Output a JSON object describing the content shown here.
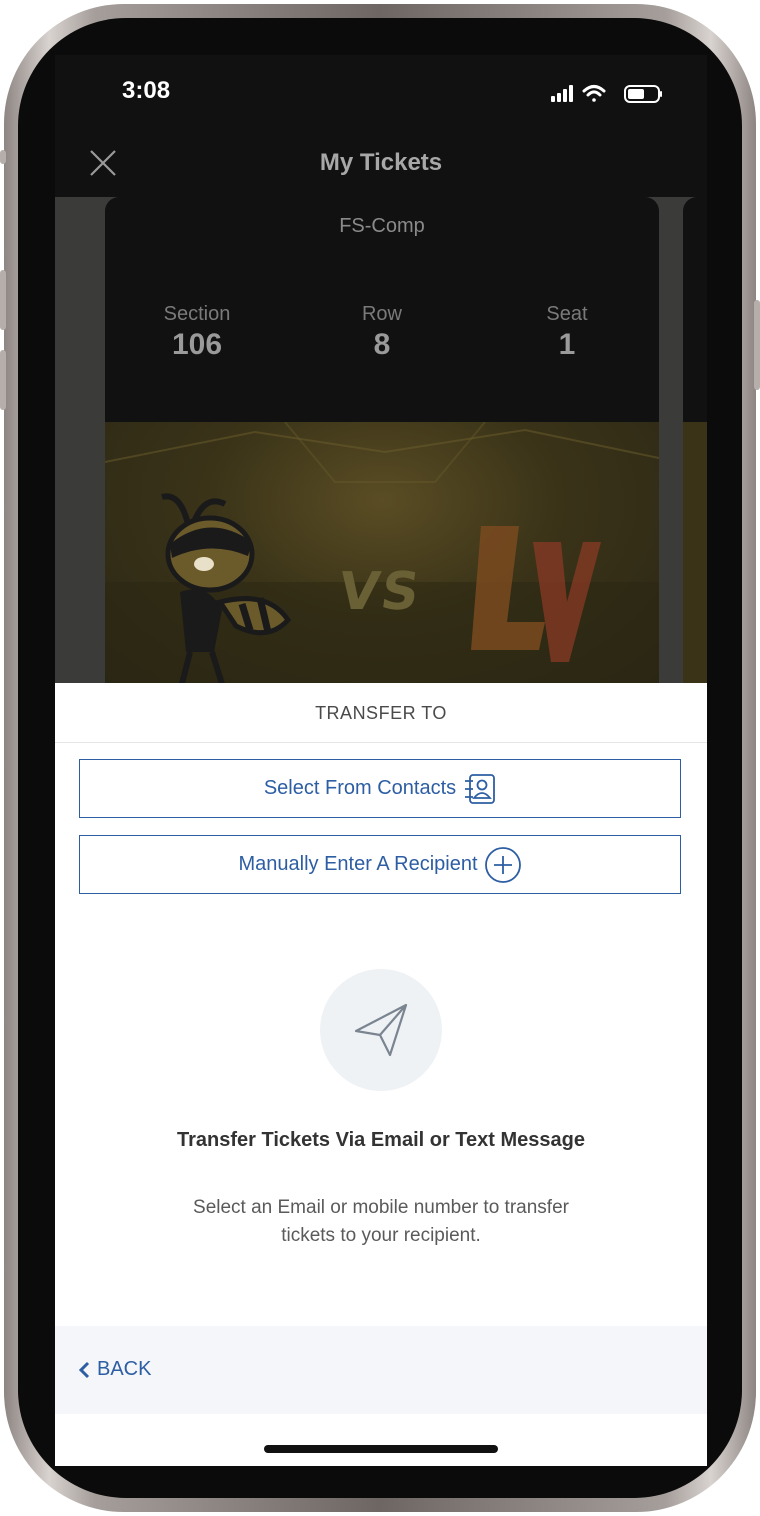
{
  "status_bar": {
    "time": "3:08"
  },
  "nav": {
    "title": "My Tickets"
  },
  "ticket": {
    "price_code": "FS-Comp",
    "section_label": "Section",
    "section_value": "106",
    "row_label": "Row",
    "row_value": "8",
    "seat_label": "Seat",
    "seat_value": "1",
    "matchup_text": "VS",
    "away_logo_text": "LV"
  },
  "transfer_sheet": {
    "title": "TRANSFER TO",
    "select_contacts_label": "Select From Contacts",
    "manual_entry_label": "Manually Enter A Recipient",
    "empty_title": "Transfer Tickets Via Email or Text Message",
    "empty_body": "Select an Email or mobile number to transfer tickets to your recipient.",
    "back_label": "BACK"
  },
  "colors": {
    "accent": "#2d5ea3",
    "back_bar": "#f4f6f9"
  },
  "icons": [
    "close-icon",
    "signal-icon",
    "wifi-icon",
    "battery-icon",
    "contacts-book-icon",
    "plus-circle-icon",
    "paper-plane-icon",
    "chevron-left-icon"
  ]
}
